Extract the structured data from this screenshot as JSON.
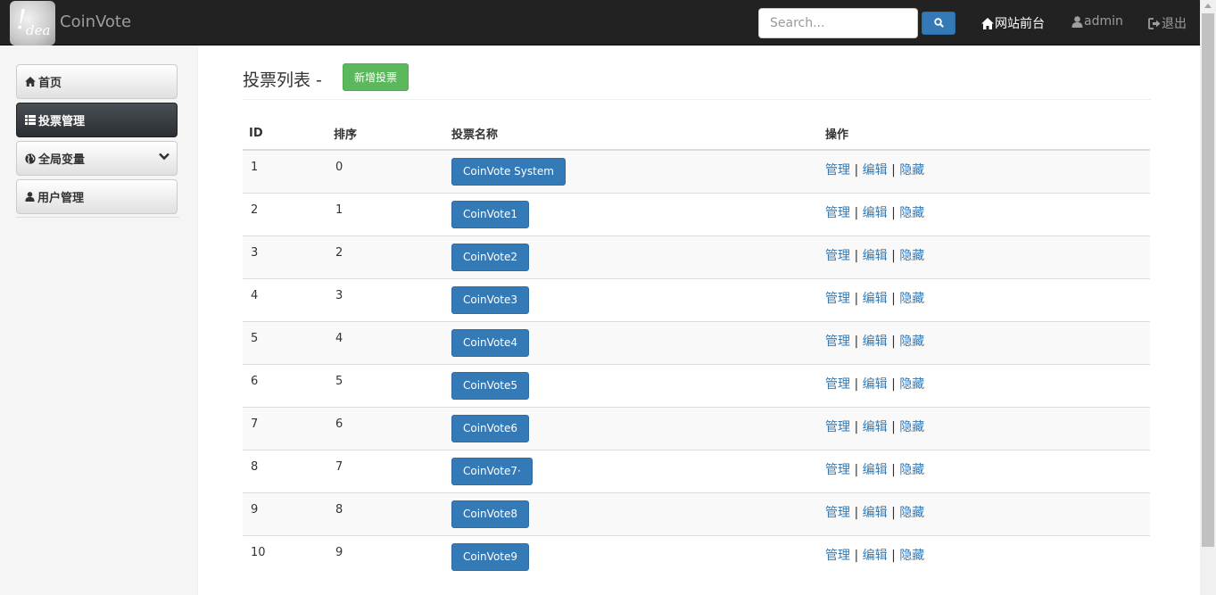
{
  "navbar": {
    "logo_text": "! dea",
    "brand": "CoinVote",
    "search_placeholder": "Search...",
    "links": {
      "frontend": "网站前台",
      "user": "admin",
      "logout": "退出"
    }
  },
  "sidebar": {
    "items": [
      {
        "label": "首页",
        "icon": "home-icon"
      },
      {
        "label": "投票管理",
        "icon": "list-icon",
        "active": true
      },
      {
        "label": "全局变量",
        "icon": "globe-icon"
      },
      {
        "label": "用户管理",
        "icon": "user-icon"
      }
    ]
  },
  "main": {
    "title": "投票列表 -",
    "add_button": "新增投票",
    "table": {
      "headers": [
        "ID",
        "排序",
        "投票名称",
        "操作"
      ],
      "actions": [
        "管理",
        "编辑",
        "隐藏"
      ],
      "rows": [
        {
          "id": "1",
          "order": "0",
          "name": "CoinVote System"
        },
        {
          "id": "2",
          "order": "1",
          "name": "CoinVote1"
        },
        {
          "id": "3",
          "order": "2",
          "name": "CoinVote2"
        },
        {
          "id": "4",
          "order": "3",
          "name": "CoinVote3"
        },
        {
          "id": "5",
          "order": "4",
          "name": "CoinVote4"
        },
        {
          "id": "6",
          "order": "5",
          "name": "CoinVote5"
        },
        {
          "id": "7",
          "order": "6",
          "name": "CoinVote6"
        },
        {
          "id": "8",
          "order": "7",
          "name": "CoinVote7·"
        },
        {
          "id": "9",
          "order": "8",
          "name": "CoinVote8"
        },
        {
          "id": "10",
          "order": "9",
          "name": "CoinVote9"
        }
      ]
    }
  },
  "colors": {
    "navbar_bg": "#222222",
    "primary": "#337ab7",
    "success": "#5cb85c",
    "sidebar_active": "#2b2f33"
  }
}
